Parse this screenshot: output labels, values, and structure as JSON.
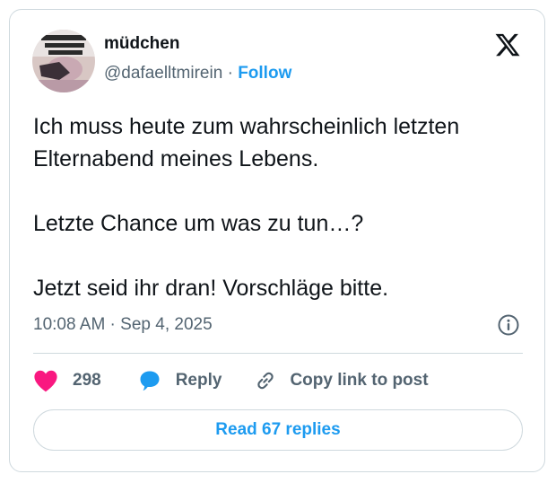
{
  "user": {
    "display_name": "müdchen",
    "handle": "@dafaelltmirein",
    "separator": "·",
    "follow_label": "Follow"
  },
  "tweet": {
    "paragraphs": [
      "Ich muss heute zum wahrscheinlich letzten Elternabend meines Lebens.",
      "Letzte Chance um was zu tun…?",
      "Jetzt seid ihr dran! Vorschläge bitte."
    ],
    "timestamp": "10:08 AM · Sep 4, 2025"
  },
  "actions": {
    "likes_count": "298",
    "reply_label": "Reply",
    "copy_link_label": "Copy link to post"
  },
  "read_replies_label": "Read 67 replies",
  "icons": {
    "logo": "x-logo-icon",
    "info": "info-icon",
    "like": "heart-icon",
    "reply": "speech-bubble-icon",
    "copy": "link-icon"
  },
  "colors": {
    "accent": "#1d9bf0",
    "heart": "#f91880",
    "muted_text": "#536471",
    "border": "#cfd9de"
  }
}
